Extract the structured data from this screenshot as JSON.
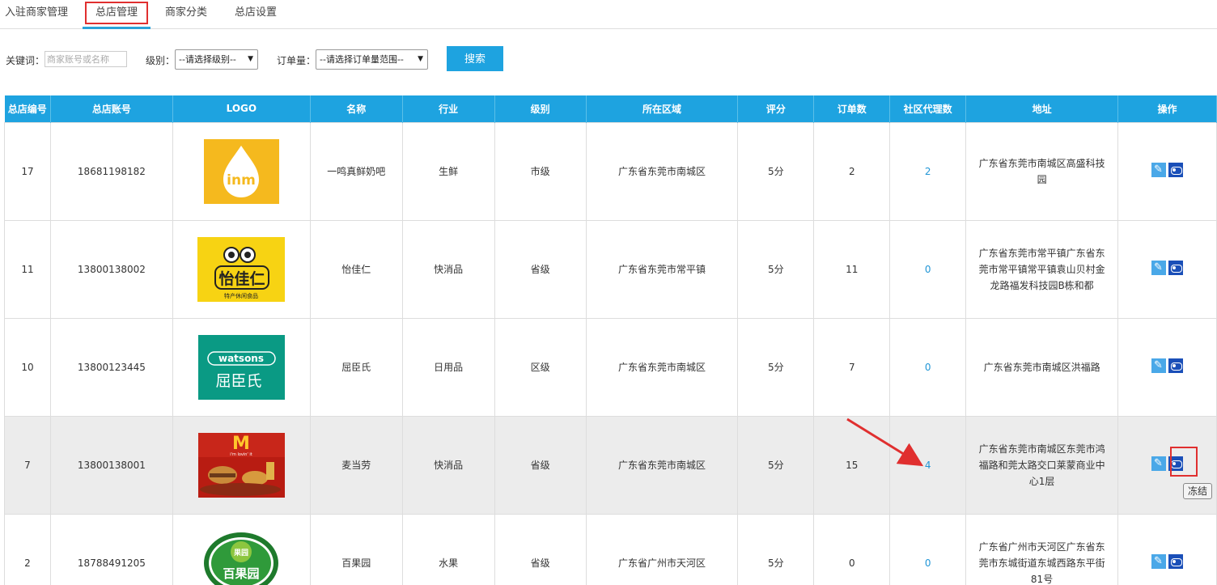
{
  "tabs": [
    {
      "label": "入驻商家管理"
    },
    {
      "label": "总店管理"
    },
    {
      "label": "商家分类"
    },
    {
      "label": "总店设置"
    }
  ],
  "filters": {
    "keyword_label": "关键词：",
    "keyword_placeholder": "商家账号或名称",
    "level_label": "级别：",
    "level_value": "--请选择级别--",
    "orders_label": "订单量：",
    "orders_value": "--请选择订单量范围--",
    "search_label": "搜索"
  },
  "table": {
    "headers": [
      "总店编号",
      "总店账号",
      "LOGO",
      "名称",
      "行业",
      "级别",
      "所在区域",
      "评分",
      "订单数",
      "社区代理数",
      "地址",
      "操作"
    ],
    "rows": [
      {
        "id": "17",
        "account": "18681198182",
        "logo": "inm-logo",
        "name": "一鸣真鲜奶吧",
        "industry": "生鲜",
        "level": "市级",
        "region": "广东省东莞市南城区",
        "rating": "5分",
        "orders": "2",
        "agents": "2",
        "address": "广东省东莞市南城区高盛科技园"
      },
      {
        "id": "11",
        "account": "13800138002",
        "logo": "yijiaren-logo",
        "name": "怡佳仁",
        "industry": "快消品",
        "level": "省级",
        "region": "广东省东莞市常平镇",
        "rating": "5分",
        "orders": "11",
        "agents": "0",
        "address": "广东省东莞市常平镇广东省东莞市常平镇常平镇袁山贝村金龙路福发科技园B栋和都"
      },
      {
        "id": "10",
        "account": "13800123445",
        "logo": "watsons-logo",
        "name": "屈臣氏",
        "industry": "日用品",
        "level": "区级",
        "region": "广东省东莞市南城区",
        "rating": "5分",
        "orders": "7",
        "agents": "0",
        "address": "广东省东莞市南城区洪福路"
      },
      {
        "id": "7",
        "account": "13800138001",
        "logo": "mcdonalds-logo",
        "name": "麦当劳",
        "industry": "快消品",
        "level": "省级",
        "region": "广东省东莞市南城区",
        "rating": "5分",
        "orders": "15",
        "agents": "4",
        "address": "广东省东莞市南城区东莞市鸿福路和莞太路交口莱蒙商业中心1层"
      },
      {
        "id": "2",
        "account": "18788491205",
        "logo": "baiguoyuan-logo",
        "name": "百果园",
        "industry": "水果",
        "level": "省级",
        "region": "广东省广州市天河区",
        "rating": "5分",
        "orders": "0",
        "agents": "0",
        "address": "广东省广州市天河区广东省东莞市东城街道东城西路东平街81号"
      }
    ]
  },
  "logo_text": {
    "inm": "inm",
    "yijiaren": "怡佳仁",
    "yijiaren_sub": "特产休闲食品",
    "watsons": "watsons",
    "watsons_cn": "屈臣氏",
    "mcd": "M",
    "mcd_sub": "i'm lovin' it",
    "bgy": "百果园",
    "bgy_top": "果园"
  },
  "tooltip": "冻结",
  "colors": {
    "accent": "#1ea3e0",
    "highlight": "#e02f2f"
  }
}
